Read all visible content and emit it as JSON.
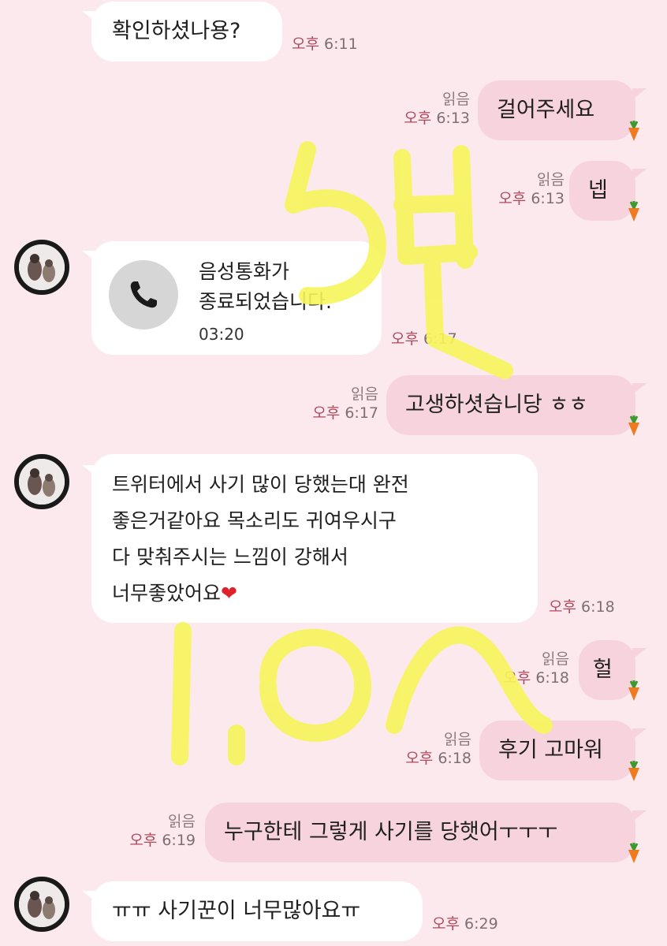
{
  "messages": [
    {
      "id": "m1",
      "dir": "in",
      "text": "확인하셨나용?",
      "ampm": "오후",
      "time": "6:11"
    },
    {
      "id": "m2",
      "dir": "out",
      "text": "걸어주세요",
      "read": "읽음",
      "ampm": "오후",
      "time": "6:13"
    },
    {
      "id": "m3",
      "dir": "out",
      "text": "넵",
      "read": "읽음",
      "ampm": "오후",
      "time": "6:13"
    },
    {
      "id": "m4",
      "dir": "in",
      "type": "call",
      "line1": "음성통화가",
      "line2": "종료되었습니다.",
      "duration": "03:20",
      "ampm": "오후",
      "time": "6:17"
    },
    {
      "id": "m5",
      "dir": "out",
      "text": "고생하셧습니당 ㅎㅎ",
      "read": "읽음",
      "ampm": "오후",
      "time": "6:17"
    },
    {
      "id": "m6",
      "dir": "in",
      "lines": [
        "트위터에서 사기 많이 당했는대 완전",
        "좋은거같아요 목소리도 귀여우시구",
        "다 맞춰주시는 느낌이 강해서",
        "너무좋았어요"
      ],
      "emoji": "❤",
      "ampm": "오후",
      "time": "6:18"
    },
    {
      "id": "m7",
      "dir": "out",
      "text": "헐",
      "read": "읽음",
      "ampm": "오후",
      "time": "6:18"
    },
    {
      "id": "m8",
      "dir": "out",
      "text": "후기 고마워",
      "read": "읽음",
      "ampm": "오후",
      "time": "6:18"
    },
    {
      "id": "m9",
      "dir": "out",
      "text": "누구한테 그렇게 사기를 당햇어ㅜㅜㅜ",
      "read": "읽음",
      "ampm": "오후",
      "time": "6:19"
    },
    {
      "id": "m10",
      "dir": "in",
      "text": "ㅠㅠ 사기꾼이 너무많아요ㅠ",
      "ampm": "오후",
      "time": "6:29"
    }
  ],
  "icons": {
    "avatar": "avatar-image",
    "call": "phone-icon",
    "sticker": "carrot-icon"
  },
  "colors": {
    "background": "#fbe9ee",
    "outgoing": "#f7d3dd",
    "incoming": "#ffffff",
    "scribble": "#f7f55a"
  }
}
